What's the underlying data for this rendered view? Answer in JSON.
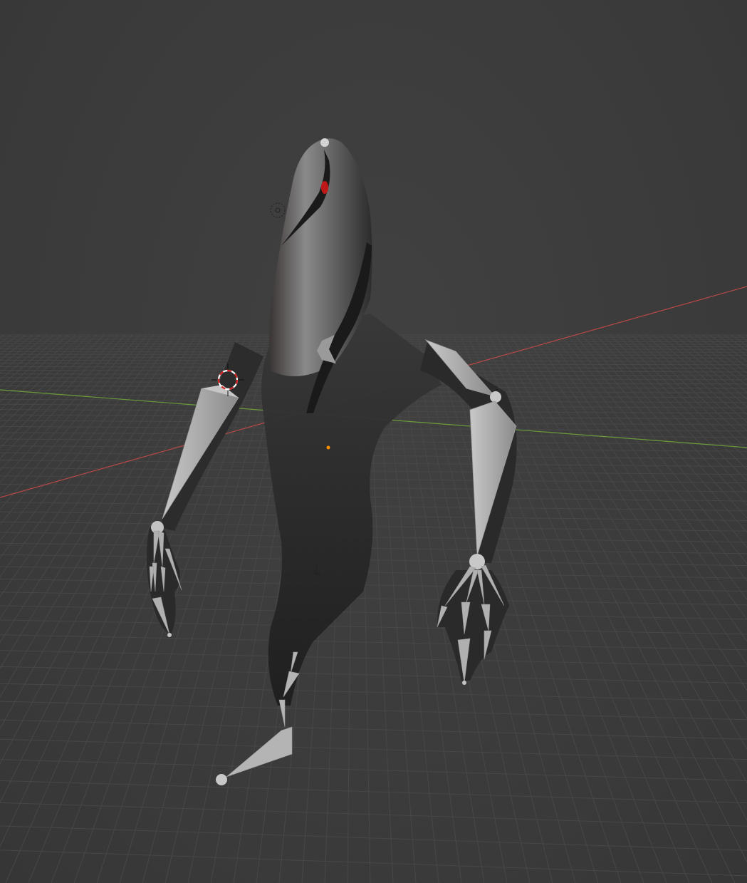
{
  "viewport": {
    "background": "#3d3d3d",
    "grid_color": "#4a4a4a",
    "x_axis_color": "#b84848",
    "y_axis_color": "#6a9a3a"
  },
  "scene": {
    "mesh_color": "#2a2a2a",
    "mesh_highlight": "#8a8a8a",
    "bone_color": "#b4b4b4",
    "bone_shade": "#8c8c8c",
    "eye_color": "#c01818",
    "origin_color": "#ff8c00",
    "cursor_red": "#d41e1e",
    "cursor_white": "#ffffff"
  }
}
